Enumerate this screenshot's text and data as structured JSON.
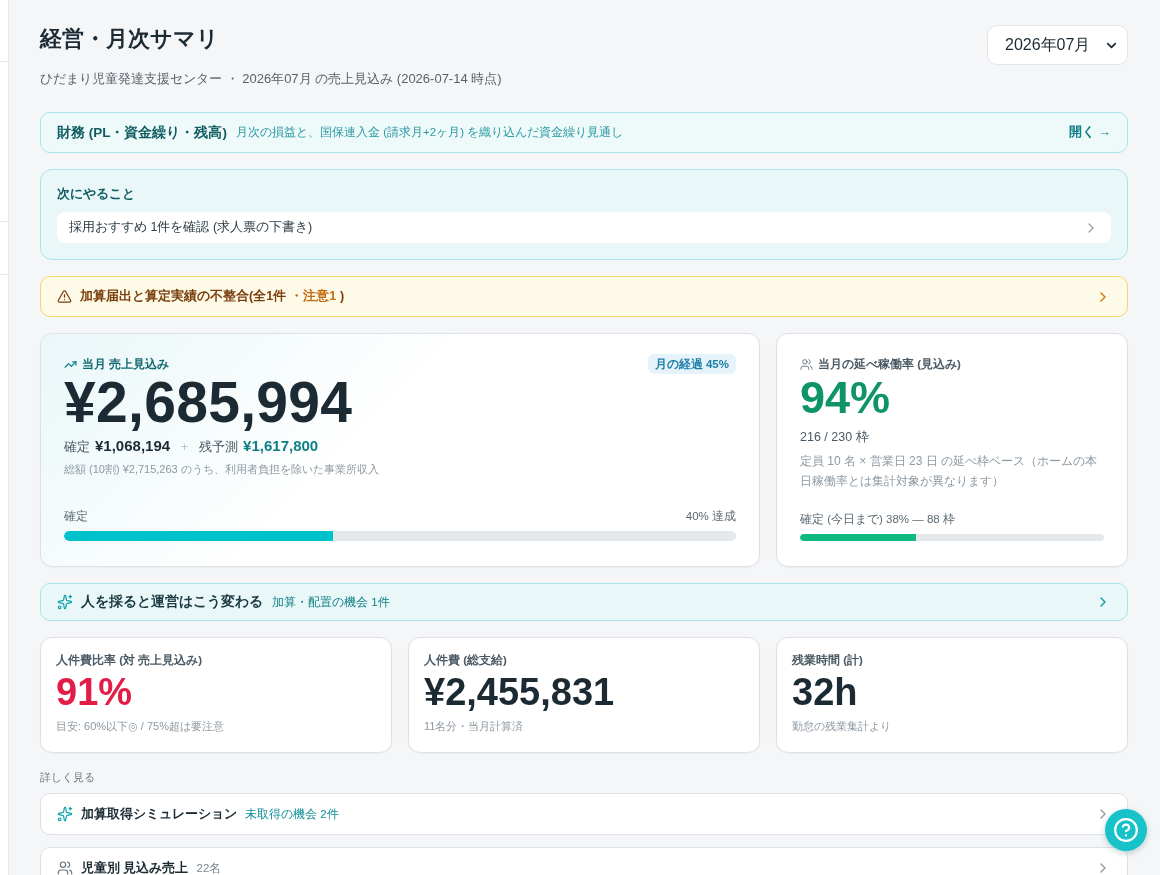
{
  "header": {
    "title": "経営・月次サマリ",
    "subtitle": "ひだまり児童発達支援センター ・ 2026年07月 の売上見込み (2026-07-14 時点)",
    "month_select": {
      "value": "2026年07月"
    }
  },
  "finance_banner": {
    "title": "財務 (PL・資金繰り・残高)",
    "description": "月次の損益と、国保連入金 (請求月+2ヶ月) を織り込んだ資金繰り見通し",
    "action": "開く →"
  },
  "next_actions": {
    "heading": "次にやること",
    "items": [
      {
        "label": "採用おすすめ 1件を確認 (求人票の下書き)"
      }
    ]
  },
  "alert": {
    "title": "加算届出と算定実績の不整合(全1件",
    "caution": "・注意1",
    "close": ")"
  },
  "sales_card": {
    "label": "当月 売上見込み",
    "badge": "月の経過 45%",
    "amount": "¥2,685,994",
    "confirmed_label": "確定",
    "confirmed_amount": "¥1,068,194",
    "plus": "+",
    "remaining_label": "残予測",
    "remaining_amount": "¥1,617,800",
    "note": "総額 (10割) ¥2,715,263 のうち、利用者負担を除いた事業所収入",
    "progress": {
      "label": "確定",
      "reading": "40% 達成",
      "level": 0.4
    }
  },
  "occupancy_card": {
    "label": "当月の延べ稼働率 (見込み)",
    "rate": "94%",
    "slots": "216 / 230 枠",
    "note": "定員 10 名 × 営業日 23 日 の延べ枠ベース（ホームの本日稼働率とは集計対象が異なります）",
    "progress": {
      "label": "確定 (今日まで) 38% — 88 枠",
      "level": 0.38
    }
  },
  "hiring_banner": {
    "title": "人を採ると運営はこう変わる",
    "detail": "加算・配置の機会 1件"
  },
  "kpis": [
    {
      "label": "人件費比率 (対 売上見込み)",
      "value": "91%",
      "alert": true,
      "note": "目安: 60%以下◎ / 75%超は要注意"
    },
    {
      "label": "人件費 (総支給)",
      "value": "¥2,455,831",
      "alert": false,
      "note": "11名分・当月計算済"
    },
    {
      "label": "残業時間 (計)",
      "value": "32h",
      "alert": false,
      "note": "勤怠の残業集計より"
    }
  ],
  "details": {
    "heading": "詳しく見る",
    "links": [
      {
        "kind": "sparkle",
        "title": "加算取得シミュレーション",
        "detail": "未取得の機会 2件",
        "highlight": true
      },
      {
        "kind": "people",
        "title": "児童別 見込み売上",
        "detail": "22名",
        "highlight": false
      }
    ]
  }
}
